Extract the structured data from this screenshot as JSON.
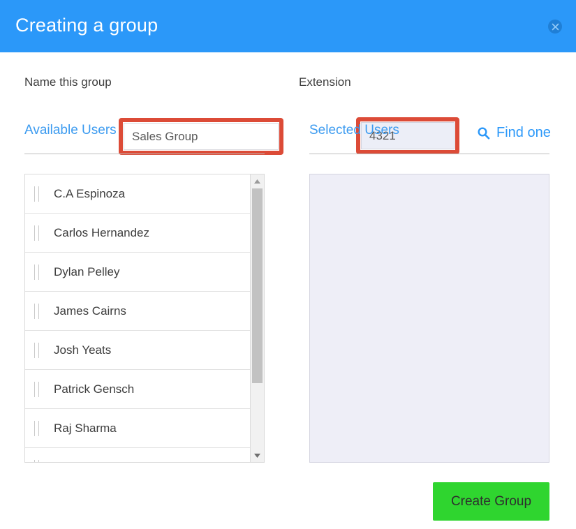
{
  "dialog": {
    "title": "Creating a group",
    "close_icon": "close-icon"
  },
  "form": {
    "name_label": "Name this group",
    "name_value": "Sales Group",
    "name_placeholder": "Name this group",
    "extension_label": "Extension",
    "extension_value": "4321",
    "extension_placeholder": "Extension",
    "find_one_label": "Find one",
    "find_one_icon": "search-icon",
    "highlight_color": "#dc4b37"
  },
  "available": {
    "heading": "Available Users",
    "users": [
      {
        "name": "C.A Espinoza"
      },
      {
        "name": "Carlos Hernandez"
      },
      {
        "name": "Dylan Pelley"
      },
      {
        "name": "James Cairns"
      },
      {
        "name": "Josh Yeats"
      },
      {
        "name": "Patrick Gensch"
      },
      {
        "name": "Raj Sharma"
      },
      {
        "name": ""
      }
    ],
    "scrollbar": {
      "up_icon": "triangle-up-icon",
      "down_icon": "triangle-down-icon"
    }
  },
  "selected": {
    "heading": "Selected Users",
    "users": []
  },
  "footer": {
    "create_label": "Create Group",
    "create_color": "#2fd52f"
  }
}
